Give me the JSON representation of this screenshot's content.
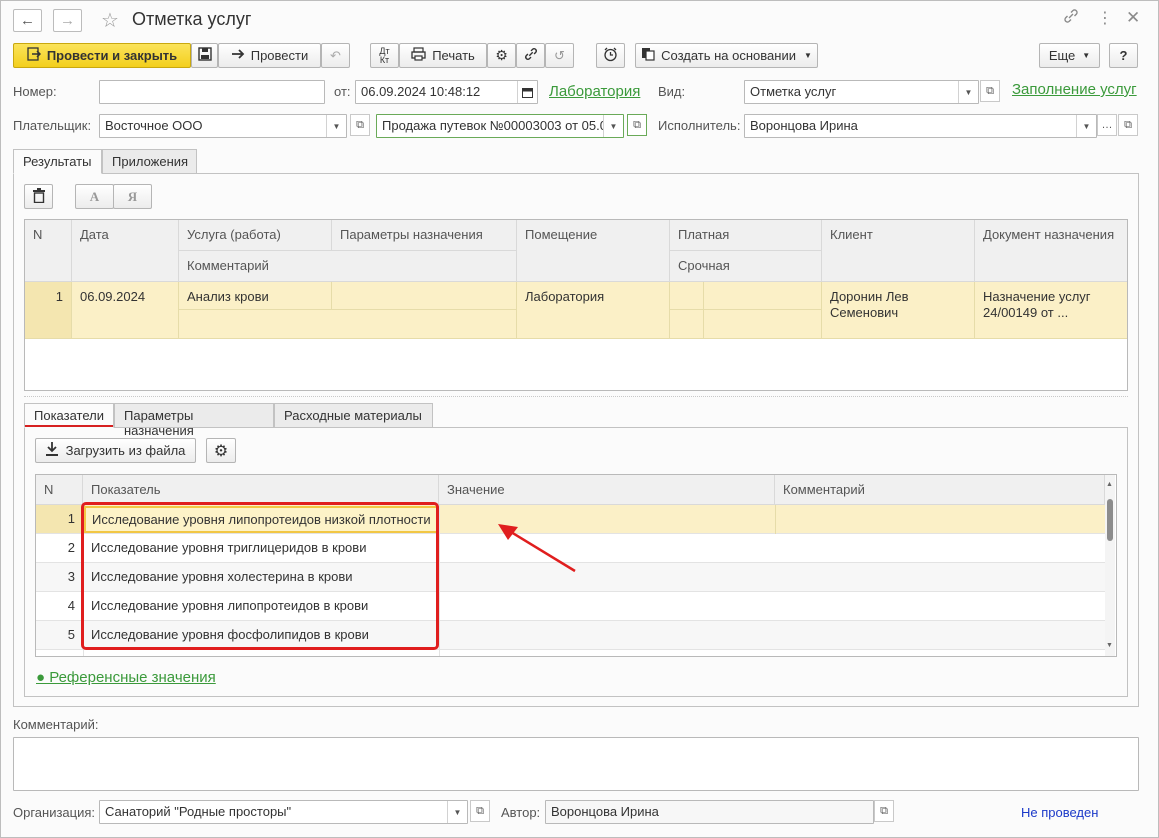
{
  "window": {
    "title": "Отметка услуг",
    "nav_back_icon": "←",
    "nav_forward_icon": "→"
  },
  "toolbar": {
    "post_and_close": "Провести и закрыть",
    "post": "Провести",
    "print": "Печать",
    "create_based_on": "Создать на основании",
    "more": "Еще",
    "help": "?"
  },
  "header": {
    "number_label": "Номер:",
    "number_value": "",
    "date_label": "от:",
    "date_value": "06.09.2024 10:48:12",
    "lab_link": "Лаборатория",
    "kind_label": "Вид:",
    "kind_value": "Отметка услуг",
    "fill_link": "Заполнение услуг",
    "payer_label": "Плательщик:",
    "payer_value": "Восточное ООО",
    "sale_value": "Продажа путевок №00003003 от 05.0",
    "executor_label": "Исполнитель:",
    "executor_value": "Воронцова Ирина"
  },
  "tabs": [
    "Результаты",
    "Приложения"
  ],
  "results_toolbar": {
    "az": "А",
    "za": "Я"
  },
  "results_grid": {
    "headers": {
      "n": "N",
      "date": "Дата",
      "service": "Услуга (работа)",
      "params": "Параметры назначения",
      "comment": "Комментарий",
      "room": "Помещение",
      "paid": "Платная",
      "urgent": "Срочная",
      "client": "Клиент",
      "doc": "Документ назначения"
    },
    "row": {
      "n": "1",
      "date": "06.09.2024",
      "service": "Анализ крови",
      "room": "Лаборатория",
      "client": "Доронин Лев Семенович",
      "doc": "Назначение услуг 24/00149 от ..."
    }
  },
  "subtabs": [
    "Показатели",
    "Параметры назначения",
    "Расходные материалы"
  ],
  "indicators": {
    "load_button": "Загрузить из файла",
    "headers": {
      "n": "N",
      "indicator": "Показатель",
      "value": "Значение",
      "comment": "Комментарий"
    },
    "rows": [
      {
        "n": "1",
        "name": "Исследование уровня липопротеидов низкой плотности"
      },
      {
        "n": "2",
        "name": "Исследование уровня триглицеридов в крови"
      },
      {
        "n": "3",
        "name": "Исследование уровня холестерина в крови"
      },
      {
        "n": "4",
        "name": "Исследование уровня липопротеидов в крови"
      },
      {
        "n": "5",
        "name": "Исследование уровня фосфолипидов в крови"
      }
    ],
    "reference_link": "● Референсные значения"
  },
  "footer": {
    "comment_label": "Комментарий:",
    "comment_value": "",
    "org_label": "Организация:",
    "org_value": "Санаторий \"Родные просторы\"",
    "author_label": "Автор:",
    "author_value": "Воронцова Ирина",
    "status": "Не проведен"
  },
  "colors": {
    "primary_button": "#f3cf1d",
    "selected_row": "#fbf0c7",
    "highlight_outline": "#e01e1e",
    "link_green": "#3b9a3b",
    "status_blue": "#1b39c8"
  }
}
